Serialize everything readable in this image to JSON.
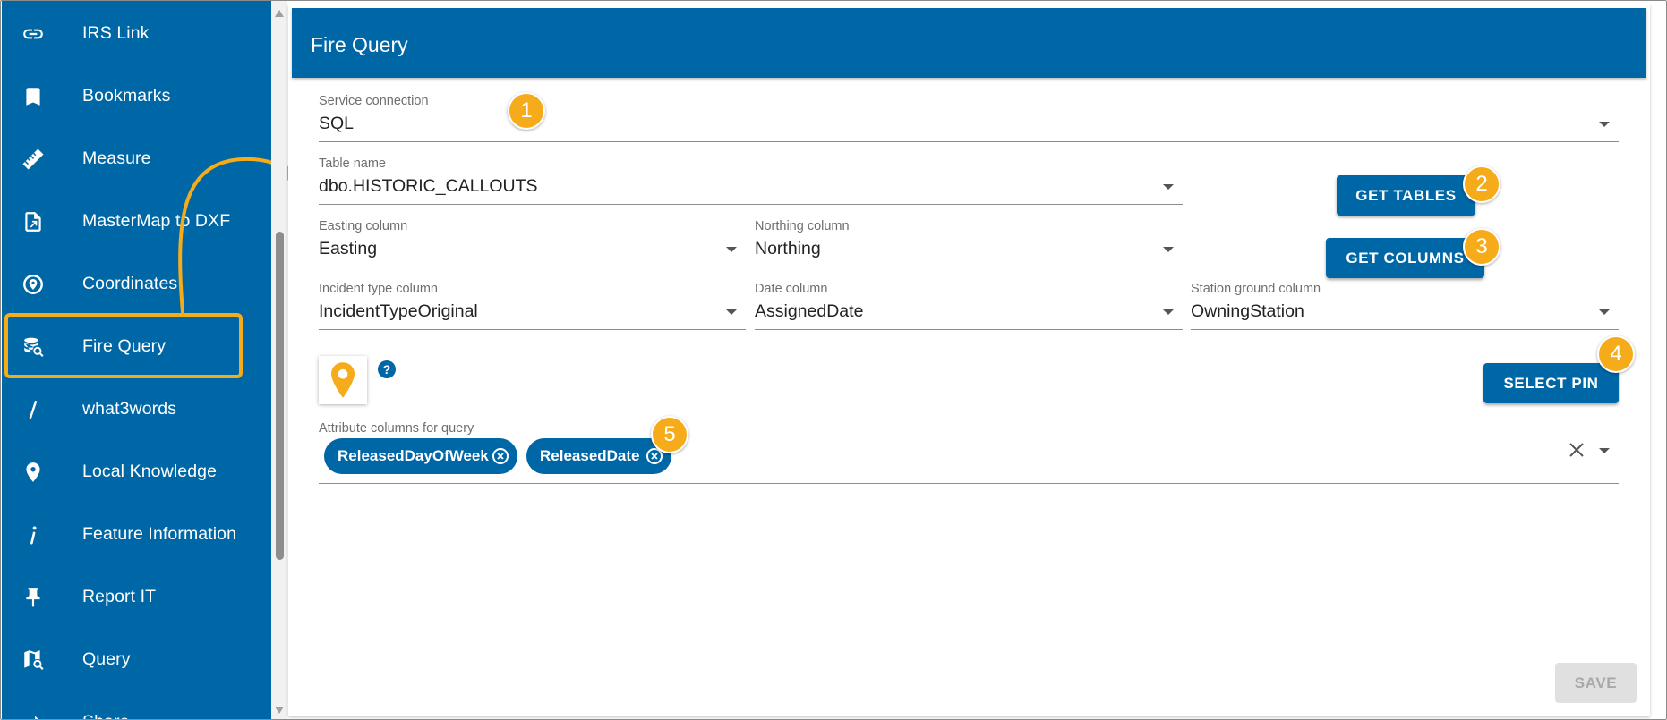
{
  "sidebar": {
    "items": [
      {
        "label": "IRS Link",
        "icon": "link-icon"
      },
      {
        "label": "Bookmarks",
        "icon": "bookmark-icon"
      },
      {
        "label": "Measure",
        "icon": "ruler-icon"
      },
      {
        "label": "MasterMap to DXF",
        "icon": "export-file-icon"
      },
      {
        "label": "Coordinates",
        "icon": "location-target-icon"
      },
      {
        "label": "Fire Query",
        "icon": "database-search-icon",
        "active": true
      },
      {
        "label": "what3words",
        "icon": "slash-icon"
      },
      {
        "label": "Local Knowledge",
        "icon": "map-pin-icon"
      },
      {
        "label": "Feature Information",
        "icon": "info-icon"
      },
      {
        "label": "Report IT",
        "icon": "pushpin-icon"
      },
      {
        "label": "Query",
        "icon": "map-search-icon"
      },
      {
        "label": "Share",
        "icon": "share-icon"
      }
    ]
  },
  "panel": {
    "title": "Fire Query"
  },
  "form": {
    "service_connection": {
      "label": "Service connection",
      "value": "SQL"
    },
    "table_name": {
      "label": "Table name",
      "value": "dbo.HISTORIC_CALLOUTS"
    },
    "easting": {
      "label": "Easting column",
      "value": "Easting"
    },
    "northing": {
      "label": "Northing column",
      "value": "Northing"
    },
    "incident_type": {
      "label": "Incident type column",
      "value": "IncidentTypeOriginal"
    },
    "date": {
      "label": "Date column",
      "value": "AssignedDate"
    },
    "station_ground": {
      "label": "Station ground column",
      "value": "OwningStation"
    },
    "attributes": {
      "label": "Attribute columns for query",
      "chips": [
        "ReleasedDayOfWeek",
        "ReleasedDate"
      ]
    },
    "help_mark": "?"
  },
  "buttons": {
    "get_tables": "GET TABLES",
    "get_columns": "GET COLUMNS",
    "select_pin": "SELECT PIN",
    "save": "SAVE"
  },
  "badges": [
    "1",
    "2",
    "3",
    "4",
    "5"
  ],
  "colors": {
    "primary": "#0067a6",
    "annotation": "#f6ab1a",
    "disabled": "#e0e0e0"
  }
}
